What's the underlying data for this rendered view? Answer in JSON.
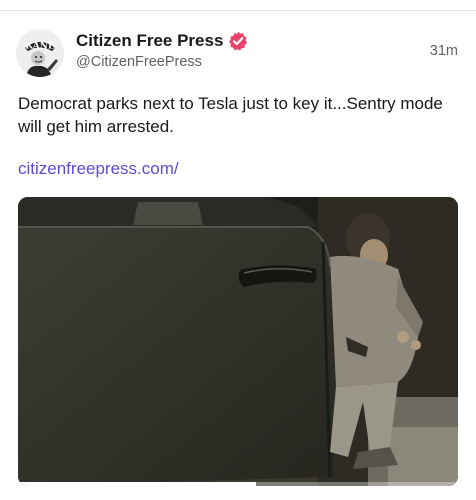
{
  "author": {
    "display_name": "Citizen Free Press",
    "handle": "@CitizenFreePress",
    "avatar_label": "KANE"
  },
  "timestamp": "31m",
  "post": {
    "text": "Democrat parks next to Tesla just to key it...Sentry mode will get him arrested.",
    "link_text": "citizenfreepress.com/"
  },
  "media": {
    "type": "video",
    "progress_fraction": 0.54
  },
  "colors": {
    "verified_badge": "#e8436b",
    "link": "#5b4dd6",
    "secondary_text": "#5f6368"
  },
  "icons": {
    "verified": "verified-badge-icon"
  }
}
